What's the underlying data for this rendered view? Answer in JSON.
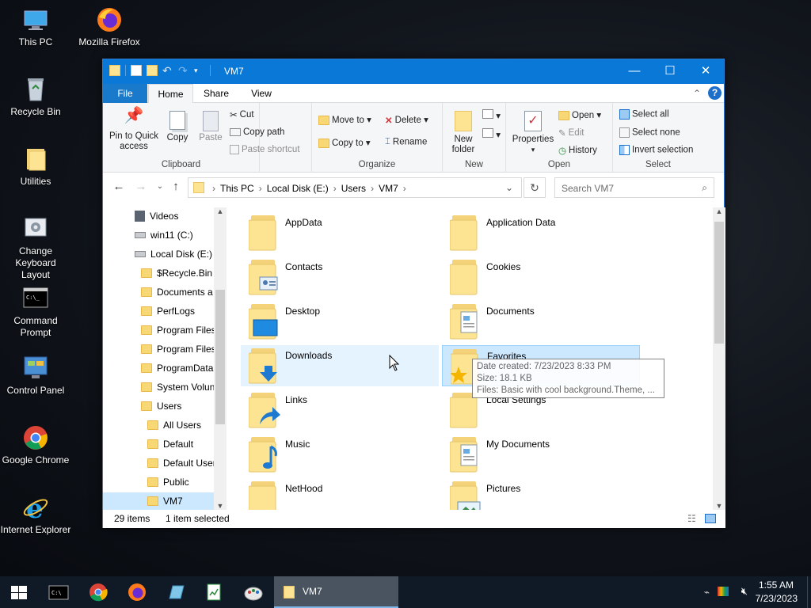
{
  "desktop": {
    "icons": [
      {
        "label": "This PC",
        "icon": "this-pc-icon"
      },
      {
        "label": "Mozilla Firefox",
        "icon": "firefox-icon"
      },
      {
        "label": "Recycle Bin",
        "icon": "recycle-bin-icon"
      },
      {
        "label": "Utilities",
        "icon": "folder-icon"
      },
      {
        "label": "Change Keyboard Layout",
        "icon": "keyboard-settings-icon"
      },
      {
        "label": "Command Prompt",
        "icon": "command-prompt-icon"
      },
      {
        "label": "Control Panel",
        "icon": "control-panel-icon"
      },
      {
        "label": "Google Chrome",
        "icon": "chrome-icon"
      },
      {
        "label": "Internet Explorer",
        "icon": "internet-explorer-icon"
      }
    ]
  },
  "window": {
    "title": "VM7",
    "controls": {
      "minimize": "—",
      "maximize": "☐",
      "close": "✕"
    }
  },
  "menu": {
    "file": "File",
    "home": "Home",
    "share": "Share",
    "view": "View"
  },
  "ribbon": {
    "clipboard": {
      "label": "Clipboard",
      "pin": "Pin to Quick access",
      "copy": "Copy",
      "paste": "Paste",
      "cut": "Cut",
      "copy_path": "Copy path",
      "paste_shortcut": "Paste shortcut"
    },
    "organize": {
      "label": "Organize",
      "move_to": "Move to",
      "copy_to": "Copy to",
      "delete": "Delete",
      "rename": "Rename"
    },
    "new": {
      "label": "New",
      "new_folder": "New folder"
    },
    "open": {
      "label": "Open",
      "properties": "Properties",
      "open": "Open",
      "edit": "Edit",
      "history": "History"
    },
    "select": {
      "label": "Select",
      "select_all": "Select all",
      "select_none": "Select none",
      "invert": "Invert selection"
    }
  },
  "address": {
    "crumbs": [
      "This PC",
      "Local Disk (E:)",
      "Users",
      "VM7"
    ],
    "search_placeholder": "Search VM7"
  },
  "nav_pane": {
    "items": [
      {
        "label": "Videos",
        "indent": 1,
        "type": "video"
      },
      {
        "label": "win11 (C:)",
        "indent": 1,
        "type": "drive"
      },
      {
        "label": "Local Disk (E:)",
        "indent": 1,
        "type": "drive"
      },
      {
        "label": "$Recycle.Bin",
        "indent": 2,
        "type": "folder"
      },
      {
        "label": "Documents a",
        "indent": 2,
        "type": "folder"
      },
      {
        "label": "PerfLogs",
        "indent": 2,
        "type": "folder"
      },
      {
        "label": "Program Files",
        "indent": 2,
        "type": "folder"
      },
      {
        "label": "Program Files",
        "indent": 2,
        "type": "folder"
      },
      {
        "label": "ProgramData",
        "indent": 2,
        "type": "folder"
      },
      {
        "label": "System Volun",
        "indent": 2,
        "type": "folder"
      },
      {
        "label": "Users",
        "indent": 2,
        "type": "folder"
      },
      {
        "label": "All Users",
        "indent": 3,
        "type": "folder"
      },
      {
        "label": "Default",
        "indent": 3,
        "type": "folder"
      },
      {
        "label": "Default User",
        "indent": 3,
        "type": "folder"
      },
      {
        "label": "Public",
        "indent": 3,
        "type": "folder"
      },
      {
        "label": "VM7",
        "indent": 3,
        "type": "folder",
        "selected": true
      }
    ]
  },
  "content": {
    "items": [
      {
        "name": "AppData",
        "overlay": "none"
      },
      {
        "name": "Application Data",
        "overlay": "none"
      },
      {
        "name": "Contacts",
        "overlay": "contact-card"
      },
      {
        "name": "Cookies",
        "overlay": "none"
      },
      {
        "name": "Desktop",
        "overlay": "desktop"
      },
      {
        "name": "Documents",
        "overlay": "document"
      },
      {
        "name": "Downloads",
        "overlay": "download-arrow",
        "state": "hover"
      },
      {
        "name": "Favorites",
        "overlay": "star",
        "state": "selected"
      },
      {
        "name": "Links",
        "overlay": "link-arrow"
      },
      {
        "name": "Local Settings",
        "overlay": "none"
      },
      {
        "name": "Music",
        "overlay": "music-note"
      },
      {
        "name": "My Documents",
        "overlay": "document"
      },
      {
        "name": "NetHood",
        "overlay": "none"
      },
      {
        "name": "Pictures",
        "overlay": "picture"
      }
    ]
  },
  "tooltip": {
    "line1": "Date created: 7/23/2023 8:33 PM",
    "line2": "Size: 18.1 KB",
    "line3": "Files: Basic with cool background.Theme, ..."
  },
  "status": {
    "count": "29 items",
    "selected": "1 item selected"
  },
  "taskbar": {
    "apps": [
      "start-icon",
      "command-prompt-icon",
      "chrome-icon",
      "firefox-icon",
      "app-icon",
      "notepad-icon",
      "paint-icon"
    ],
    "active_window": "VM7",
    "time": "1:55 AM",
    "date": "7/23/2023"
  },
  "colors": {
    "accent": "#0a78d7",
    "selection": "#cce8ff",
    "hover": "#e5f3ff",
    "folder": "#fde493"
  }
}
